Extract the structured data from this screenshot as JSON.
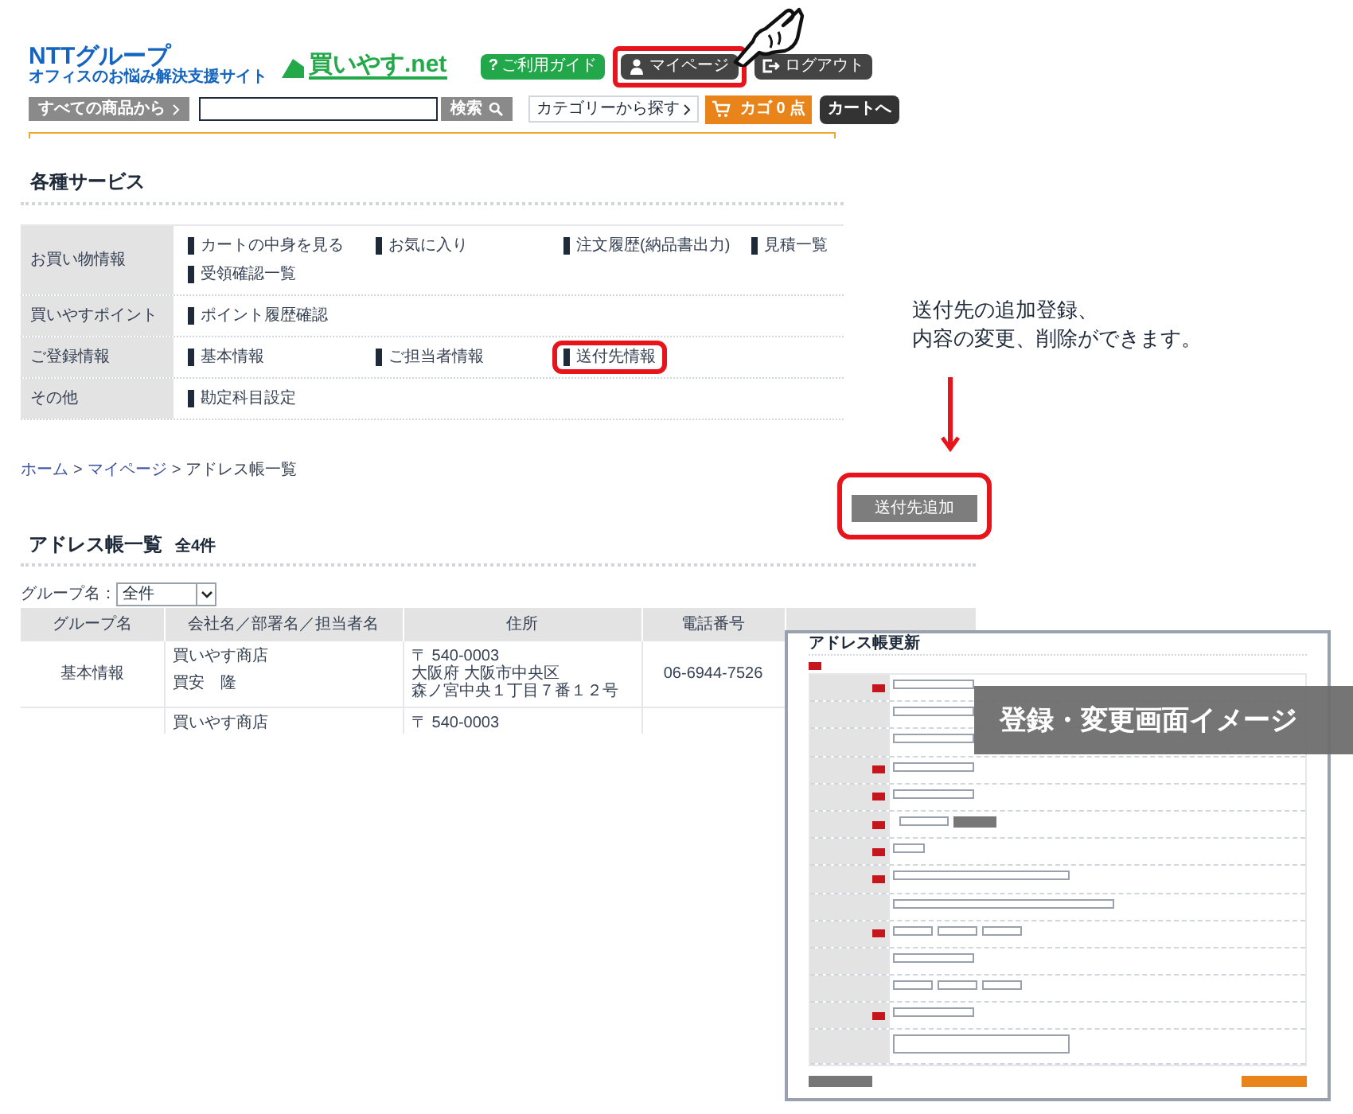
{
  "header": {
    "logo_group": "NTTグループ",
    "logo_tagline": "オフィスのお悩み解決支援サイト",
    "logo_site": "買いやす.net",
    "guide_icon": "?",
    "guide_button": "ご利用ガイド",
    "mypage_button": "マイページ",
    "mypage_highlighted": true,
    "logout_button": "ログアウト",
    "all_products_button": "すべての商品から",
    "search_button": "検索",
    "category_button": "カテゴリーから探す",
    "cart": "カゴ 0 点",
    "cart_button": "カートへ"
  },
  "services": {
    "title": "各種サービス",
    "rows": [
      {
        "label": "お買い物情報",
        "links": [
          {
            "text": "カートの中身を見る",
            "highlighted": false
          },
          {
            "text": "お気に入り",
            "highlighted": false
          },
          {
            "text": "注文履歴(納品書出力)",
            "highlighted": false
          },
          {
            "text": "見積一覧",
            "highlighted": false
          },
          {
            "text": "受領確認一覧",
            "highlighted": false
          }
        ]
      },
      {
        "label": "買いやすポイント",
        "links": [
          {
            "text": "ポイント履歴確認",
            "highlighted": false
          }
        ]
      },
      {
        "label": "ご登録情報",
        "links": [
          {
            "text": "基本情報",
            "highlighted": false
          },
          {
            "text": "ご担当者情報",
            "highlighted": false
          },
          {
            "text": "送付先情報",
            "highlighted": true
          }
        ]
      },
      {
        "label": "その他",
        "links": [
          {
            "text": "勘定科目設定",
            "highlighted": false
          }
        ]
      }
    ]
  },
  "annotation": {
    "lines": [
      "送付先の追加登録、",
      "内容の変更、削除ができます。"
    ]
  },
  "breadcrumb": {
    "separator": ">",
    "items": [
      {
        "text": "ホーム",
        "link": true
      },
      {
        "text": "マイページ",
        "link": true
      },
      {
        "text": "アドレス帳一覧",
        "link": false
      }
    ]
  },
  "address_book": {
    "add_button": "送付先追加",
    "add_button_highlighted": true,
    "title": "アドレス帳一覧",
    "count": "全4件",
    "group_filter_label": "グループ名：",
    "group_filter_value": "全件",
    "columns": [
      "グループ名",
      "会社名／部署名／担当者名",
      "住所",
      "電話番号"
    ],
    "rows": [
      {
        "group": "基本情報",
        "company_lines": [
          "買いやす商店",
          "買安　隆"
        ],
        "address_lines": [
          "〒 540-0003",
          "大阪府 大阪市中央区",
          "森ノ宮中央１丁目７番１２号"
        ],
        "phone": "06-6944-7526"
      },
      {
        "company_lines": [
          "買いやす商店"
        ],
        "address_lines": [
          "〒 540-0003"
        ]
      }
    ]
  },
  "form_image": {
    "title": "アドレス帳更新",
    "caption": "登録・変更画面イメージ",
    "rows": [
      {
        "kind": "text",
        "required": true
      },
      {
        "kind": "text",
        "required": false
      },
      {
        "kind": "text",
        "required": false
      },
      {
        "kind": "text",
        "required": true
      },
      {
        "kind": "text",
        "required": true
      },
      {
        "kind": "zip",
        "required": true
      },
      {
        "kind": "select",
        "required": true
      },
      {
        "kind": "long",
        "required": true
      },
      {
        "kind": "longer",
        "required": false
      },
      {
        "kind": "tel",
        "required": true
      },
      {
        "kind": "text",
        "required": false
      },
      {
        "kind": "tel",
        "required": false
      },
      {
        "kind": "text",
        "required": true
      },
      {
        "kind": "textarea",
        "required": false
      }
    ]
  }
}
